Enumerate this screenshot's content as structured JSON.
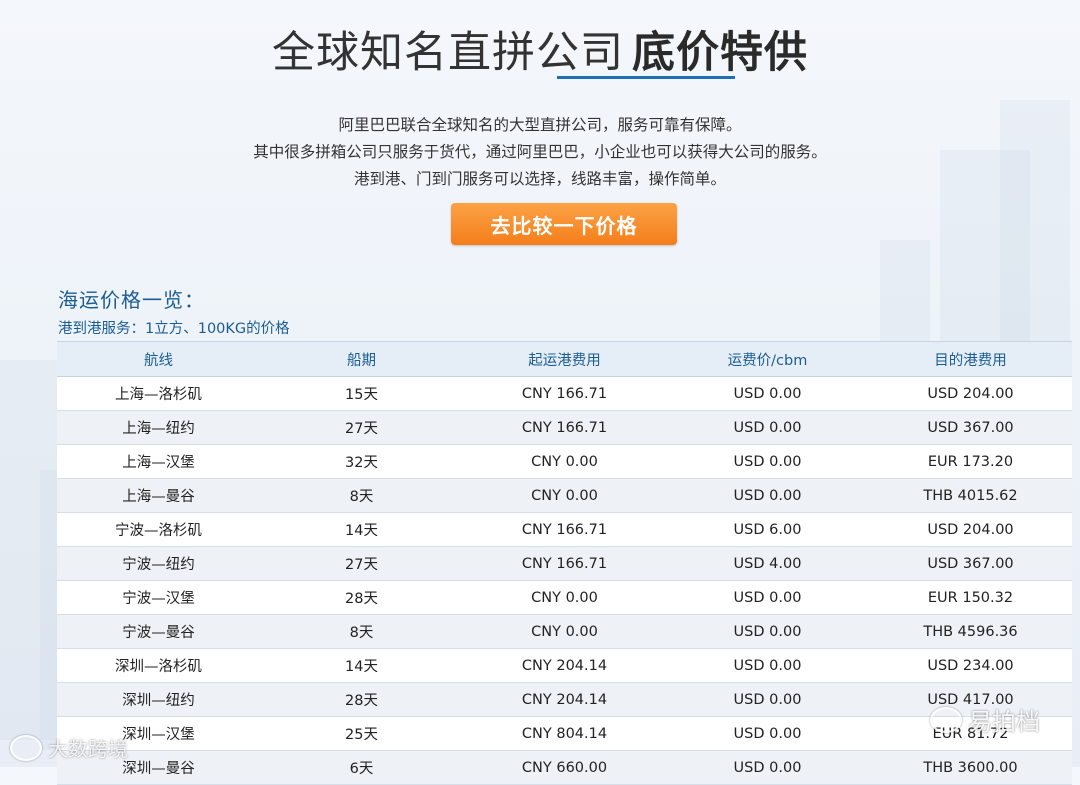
{
  "hero": {
    "title_normal": "全球知名直拼公司",
    "title_bold": "底价特供",
    "intro_lines": [
      "阿里巴巴联合全球知名的大型直拼公司，服务可靠有保障。",
      "其中很多拼箱公司只服务于货代，通过阿里巴巴，小企业也可以获得大公司的服务。",
      "港到港、门到门服务可以选择，线路丰富，操作简单。"
    ],
    "cta_label": "去比较一下价格"
  },
  "pricing": {
    "section_title": "海运价格一览：",
    "subtitle": "港到港服务：1立方、100KG的价格",
    "columns": [
      "航线",
      "船期",
      "起运港费用",
      "运费价/cbm",
      "目的港费用"
    ],
    "rows": [
      [
        "上海—洛杉矶",
        "15天",
        "CNY 166.71",
        "USD 0.00",
        "USD 204.00"
      ],
      [
        "上海—纽约",
        "27天",
        "CNY 166.71",
        "USD 0.00",
        "USD 367.00"
      ],
      [
        "上海—汉堡",
        "32天",
        "CNY 0.00",
        "USD 0.00",
        "EUR 173.20"
      ],
      [
        "上海—曼谷",
        "8天",
        "CNY 0.00",
        "USD 0.00",
        "THB 4015.62"
      ],
      [
        "宁波—洛杉矶",
        "14天",
        "CNY 166.71",
        "USD 6.00",
        "USD 204.00"
      ],
      [
        "宁波—纽约",
        "27天",
        "CNY 166.71",
        "USD 4.00",
        "USD 367.00"
      ],
      [
        "宁波—汉堡",
        "28天",
        "CNY 0.00",
        "USD 0.00",
        "EUR 150.32"
      ],
      [
        "宁波—曼谷",
        "8天",
        "CNY 0.00",
        "USD 0.00",
        "THB 4596.36"
      ],
      [
        "深圳—洛杉矶",
        "14天",
        "CNY 204.14",
        "USD 0.00",
        "USD 234.00"
      ],
      [
        "深圳—纽约",
        "28天",
        "CNY 204.14",
        "USD 0.00",
        "USD 417.00"
      ],
      [
        "深圳—汉堡",
        "25天",
        "CNY 804.14",
        "USD 0.00",
        "EUR 81.72"
      ],
      [
        "深圳—曼谷",
        "6天",
        "CNY 660.00",
        "USD 0.00",
        "THB 3600.00"
      ]
    ]
  },
  "watermarks": {
    "left": "大数跨境",
    "right": "易拍档"
  }
}
